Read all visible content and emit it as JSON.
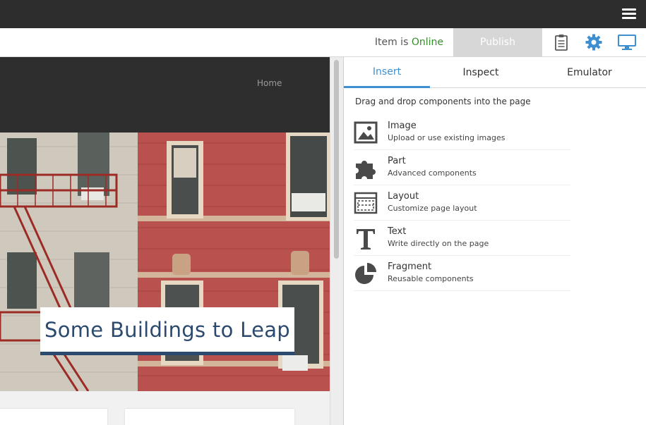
{
  "topbar": {
    "menu_icon": "hamburger-menu-icon"
  },
  "toolbar": {
    "status_prefix": "Item is",
    "status_value": "Online",
    "publish_label": "Publish",
    "icons": [
      "clipboard-icon",
      "gear-icon",
      "desktop-monitor-icon"
    ]
  },
  "preview": {
    "nav_home": "Home",
    "hero_caption": "Some Buildings to Leap"
  },
  "panel": {
    "tabs": [
      {
        "label": "Insert",
        "active": true
      },
      {
        "label": "Inspect",
        "active": false
      },
      {
        "label": "Emulator",
        "active": false
      }
    ],
    "hint": "Drag and drop components into the page",
    "components": [
      {
        "title": "Image",
        "desc": "Upload or use existing images",
        "icon": "image-icon"
      },
      {
        "title": "Part",
        "desc": "Advanced components",
        "icon": "puzzle-icon"
      },
      {
        "title": "Layout",
        "desc": "Customize page layout",
        "icon": "layout-icon"
      },
      {
        "title": "Text",
        "desc": "Write directly on the page",
        "icon": "text-icon"
      },
      {
        "title": "Fragment",
        "desc": "Reusable components",
        "icon": "pie-fragment-icon"
      }
    ]
  },
  "colors": {
    "accent": "#3d8fd1",
    "online": "#3a8d2f",
    "caption": "#2c4a6e",
    "icon_blue": "#3d8fd1"
  }
}
